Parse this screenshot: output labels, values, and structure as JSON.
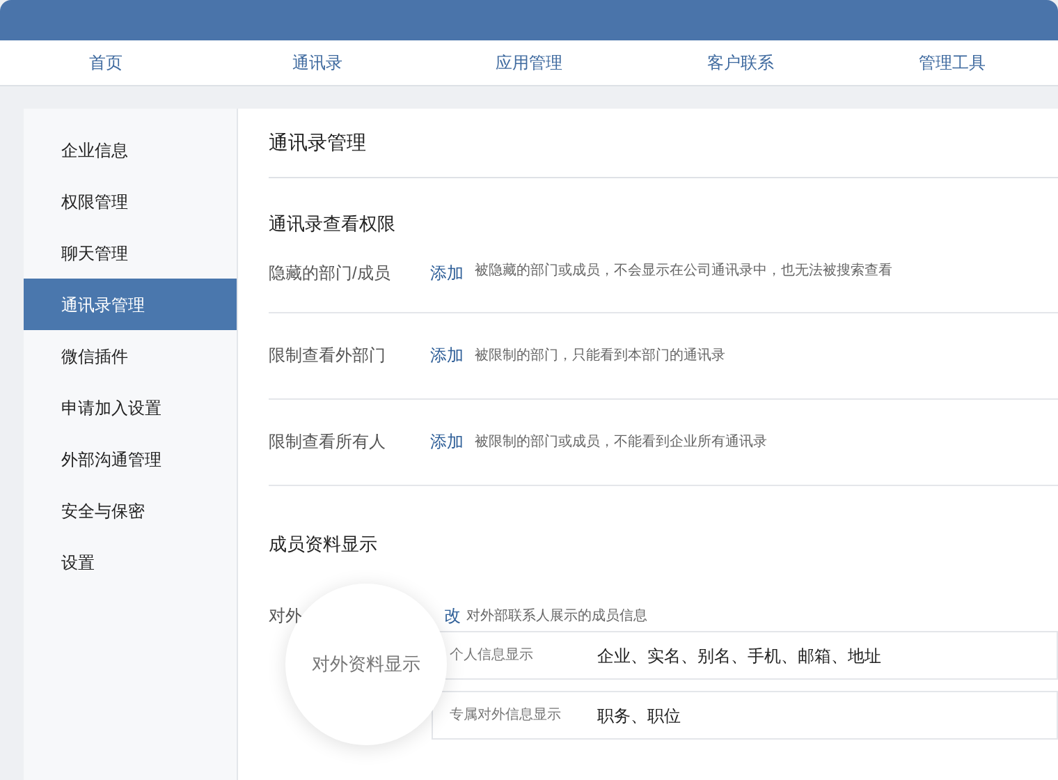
{
  "nav": [
    {
      "label": "首页"
    },
    {
      "label": "通讯录"
    },
    {
      "label": "应用管理"
    },
    {
      "label": "客户联系"
    },
    {
      "label": "管理工具"
    }
  ],
  "sidebar": {
    "items": [
      {
        "label": "企业信息",
        "selected": false
      },
      {
        "label": "权限管理",
        "selected": false
      },
      {
        "label": "聊天管理",
        "selected": false
      },
      {
        "label": "通讯录管理",
        "selected": true
      },
      {
        "label": "微信插件",
        "selected": false
      },
      {
        "label": "申请加入设置",
        "selected": false
      },
      {
        "label": "外部沟通管理",
        "selected": false
      },
      {
        "label": "安全与保密",
        "selected": false
      },
      {
        "label": "设置",
        "selected": false
      }
    ]
  },
  "page_title": "通讯录管理",
  "view_permissions": {
    "title": "通讯录查看权限",
    "rows": [
      {
        "label": "隐藏的部门/成员",
        "action": "添加",
        "description": "被隐藏的部门或成员，不会显示在公司通讯录中，也无法被搜索查看"
      },
      {
        "label": "限制查看外部门",
        "action": "添加",
        "description": "被限制的部门，只能看到本部门的通讯录"
      },
      {
        "label": "限制查看所有人",
        "action": "添加",
        "description": "被限制的部门或成员，不能看到企业所有通讯录"
      }
    ]
  },
  "member_display": {
    "title": "成员资料显示",
    "row": {
      "label": "对外",
      "action": "改",
      "description": "对外部联系人展示的成员信息"
    },
    "fields": [
      {
        "label": "个人信息显示",
        "value": "企业、实名、别名、手机、邮箱、地址"
      },
      {
        "label": "专属对外信息显示",
        "value": "职务、职位"
      }
    ]
  },
  "magnifier": {
    "text": "对外资料显示"
  }
}
